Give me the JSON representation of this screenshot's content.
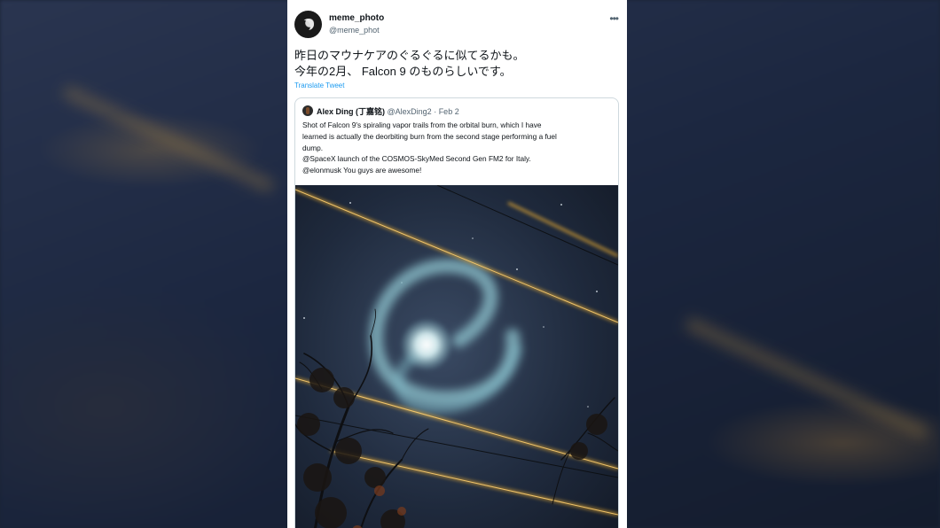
{
  "tweet": {
    "display_name": "meme_photo",
    "handle": "@meme_phot",
    "more_icon": "more-horizontal-icon",
    "text_lines": [
      "昨日のマウナケアのぐるぐるに似てるかも。",
      "今年の2月、 Falcon 9 のものらしいです。"
    ],
    "translate_label": "Translate Tweet"
  },
  "quoted": {
    "display_name": "Alex Ding (丁嘉铭)",
    "handle_date": "@AlexDing2 · Feb 2",
    "text_lines": [
      "Shot of Falcon 9's spiraling vapor trails from the orbital burn, which I have",
      "learned is actually the deorbiting burn from the second stage performing a fuel",
      "dump.",
      "@SpaceX launch of the COSMOS-SkyMed Second Gen FM2 for Italy.",
      "@elonmusk You guys are awesome!"
    ],
    "photo_icon": "spiral-night-sky-photo"
  },
  "colors": {
    "link": "#1d9bf0",
    "text": "#0f1419",
    "secondary": "#536471",
    "border": "#cfd9de"
  }
}
